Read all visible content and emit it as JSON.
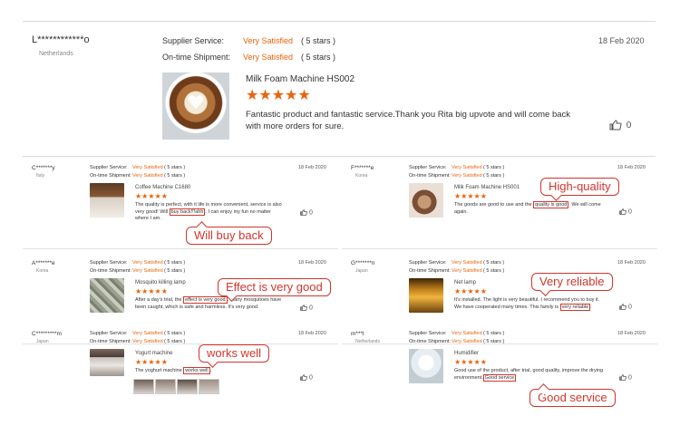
{
  "main": {
    "user": "L************o",
    "country": "Netherlands",
    "supplier_label": "Supplier Service:",
    "supplier_value": "Very Satisfied",
    "supplier_stars": "( 5 stars )",
    "shipment_label": "On-time Shipment:",
    "shipment_value": "Very Satisfied",
    "shipment_stars": "( 5 stars )",
    "date": "18 Feb 2020",
    "product": "Milk Foam Machine HS002",
    "stars": "★★★★★",
    "review": "Fantastic product and fantastic service.Thank you Rita big upvote and will come back with more orders for sure.",
    "likes": "0"
  },
  "reviews": [
    {
      "user": "C*******y",
      "country": "Italy",
      "date": "18 Feb 2020",
      "product": "Coffee Machine C1680",
      "pre": "The quality is perfect, with it life is more convenient, service is also very good! Will ",
      "hl": "buy back!!!ahh",
      "post": ". I can enjoy my fun no matter where I am.",
      "callout": "Will buy back",
      "likes": "0"
    },
    {
      "user": "F*******e",
      "country": "Korea",
      "date": "18 Feb 2020",
      "product": "Milk Foam Machine HS001",
      "pre": "The goods are good to use and the ",
      "hl": "quality is good",
      "post": ". We will come again.",
      "callout": "High-quality",
      "likes": "0"
    },
    {
      "user": "A*******e",
      "country": "Korea",
      "date": "18 Feb 2020",
      "product": "Mosquito killing lamp",
      "pre": "After a day's trial, the ",
      "hl": "effect is very good",
      "post": ". Many mosquitoes have been caught, which is safe and harmless. It's very good.",
      "callout": "Effect is very good",
      "likes": "0"
    },
    {
      "user": "G*******n",
      "country": "Japan",
      "date": "18 Feb 2020",
      "product": "Net lamp",
      "pre": "It's installed. The light is very beautiful. I recommend you to buy it. We have cooperated many times. This family is ",
      "hl": "very reliable",
      "post": ".",
      "callout": "Very reliable",
      "likes": "0"
    },
    {
      "user": "C*********m",
      "country": "Japan",
      "date": "18 Feb 2020",
      "product": "Yogurt machine",
      "pre": "The yoghurt machine ",
      "hl": "works well",
      "post": ".",
      "callout": "works well",
      "likes": "0"
    },
    {
      "user": "m***l",
      "country": "Netherlands",
      "date": "18 Feb 2020",
      "product": "Humidifier",
      "pre": "Good use of the product, after trial, good quality, improve the drying environment.",
      "hl": "Good service",
      "post": "",
      "callout": "Good service",
      "likes": "0"
    }
  ],
  "small_labels": {
    "supplier_label": "Supplier Service:",
    "shipment_label": "On-time Shipment:",
    "value": "Very Satisfied",
    "stars_text": "( 5 stars )",
    "stars": "★★★★★"
  }
}
